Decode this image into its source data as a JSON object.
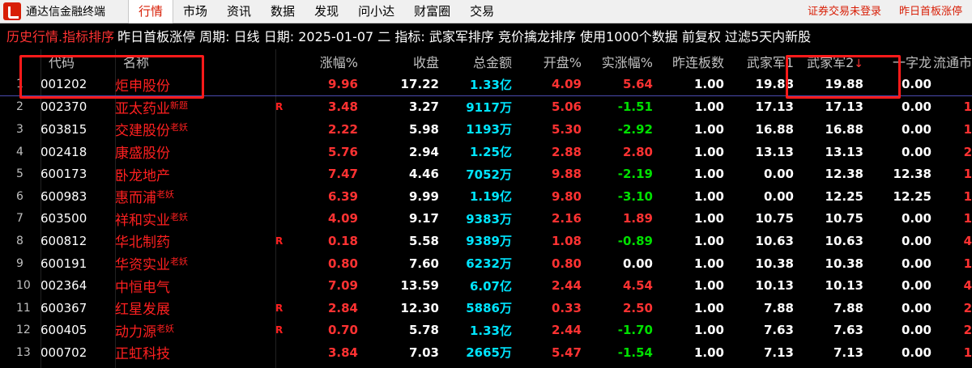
{
  "menubar": {
    "app_title": "通达信金融终端",
    "items": [
      "行情",
      "市场",
      "资讯",
      "数据",
      "发现",
      "问小达",
      "财富圈",
      "交易"
    ],
    "active": 0,
    "status_login": "证券交易未登录",
    "status_panel": "昨日首板涨停"
  },
  "infobar": {
    "history_label": "历史行情.指标排序",
    "details": "昨日首板涨停  周期: 日线  日期: 2025-01-07 二  指标: 武家军排序 竞价擒龙排序  使用1000个数据 前复权 过滤5天内新股"
  },
  "table": {
    "headers": {
      "code": "代码",
      "name": "名称",
      "pct": "涨幅%",
      "close": "收盘",
      "amount": "总金额",
      "open": "开盘%",
      "real": "实涨幅%",
      "lb": "昨连板数",
      "wj1": "武家军1",
      "wj2": "武家军2",
      "yzl": "一字龙",
      "ltz": "流通市"
    },
    "sort_arrow": "↓",
    "rows": [
      {
        "idx": "1",
        "code": "001202",
        "name": "炬申股份",
        "tag": "",
        "r": "",
        "pct": "9.96",
        "close": "17.22",
        "amount": "1.33亿",
        "open": "4.09",
        "real": "5.64",
        "lb": "1.00",
        "wj1": "19.88",
        "wj2": "19.88",
        "yzl": "0.00",
        "ltz": ""
      },
      {
        "idx": "2",
        "code": "002370",
        "name": "亚太药业",
        "tag": "新题",
        "r": "R",
        "pct": "3.48",
        "close": "3.27",
        "amount": "9117万",
        "open": "5.06",
        "real": "-1.51",
        "lb": "1.00",
        "wj1": "17.13",
        "wj2": "17.13",
        "yzl": "0.00",
        "ltz": "1"
      },
      {
        "idx": "3",
        "code": "603815",
        "name": "交建股份",
        "tag": "老妖",
        "r": "",
        "pct": "2.22",
        "close": "5.98",
        "amount": "1193万",
        "open": "5.30",
        "real": "-2.92",
        "lb": "1.00",
        "wj1": "16.88",
        "wj2": "16.88",
        "yzl": "0.00",
        "ltz": "1"
      },
      {
        "idx": "4",
        "code": "002418",
        "name": "康盛股份",
        "tag": "",
        "r": "",
        "pct": "5.76",
        "close": "2.94",
        "amount": "1.25亿",
        "open": "2.88",
        "real": "2.80",
        "lb": "1.00",
        "wj1": "13.13",
        "wj2": "13.13",
        "yzl": "0.00",
        "ltz": "2"
      },
      {
        "idx": "5",
        "code": "600173",
        "name": "卧龙地产",
        "tag": "",
        "r": "",
        "pct": "7.47",
        "close": "4.46",
        "amount": "7052万",
        "open": "9.88",
        "real": "-2.19",
        "lb": "1.00",
        "wj1": "0.00",
        "wj2": "12.38",
        "yzl": "12.38",
        "ltz": "1"
      },
      {
        "idx": "6",
        "code": "600983",
        "name": "惠而浦",
        "tag": "老妖",
        "r": "",
        "pct": "6.39",
        "close": "9.99",
        "amount": "1.19亿",
        "open": "9.80",
        "real": "-3.10",
        "lb": "1.00",
        "wj1": "0.00",
        "wj2": "12.25",
        "yzl": "12.25",
        "ltz": "1"
      },
      {
        "idx": "7",
        "code": "603500",
        "name": "祥和实业",
        "tag": "老妖",
        "r": "",
        "pct": "4.09",
        "close": "9.17",
        "amount": "9383万",
        "open": "2.16",
        "real": "1.89",
        "lb": "1.00",
        "wj1": "10.75",
        "wj2": "10.75",
        "yzl": "0.00",
        "ltz": "1"
      },
      {
        "idx": "8",
        "code": "600812",
        "name": "华北制药",
        "tag": "",
        "r": "R",
        "pct": "0.18",
        "close": "5.58",
        "amount": "9389万",
        "open": "1.08",
        "real": "-0.89",
        "lb": "1.00",
        "wj1": "10.63",
        "wj2": "10.63",
        "yzl": "0.00",
        "ltz": "4"
      },
      {
        "idx": "9",
        "code": "600191",
        "name": "华资实业",
        "tag": "老妖",
        "r": "",
        "pct": "0.80",
        "close": "7.60",
        "amount": "6232万",
        "open": "0.80",
        "real": "0.00",
        "lb": "1.00",
        "wj1": "10.38",
        "wj2": "10.38",
        "yzl": "0.00",
        "ltz": "1"
      },
      {
        "idx": "10",
        "code": "002364",
        "name": "中恒电气",
        "tag": "",
        "r": "",
        "pct": "7.09",
        "close": "13.59",
        "amount": "6.07亿",
        "open": "2.44",
        "real": "4.54",
        "lb": "1.00",
        "wj1": "10.13",
        "wj2": "10.13",
        "yzl": "0.00",
        "ltz": "4"
      },
      {
        "idx": "11",
        "code": "600367",
        "name": "红星发展",
        "tag": "",
        "r": "R",
        "pct": "2.84",
        "close": "12.30",
        "amount": "5886万",
        "open": "0.33",
        "real": "2.50",
        "lb": "1.00",
        "wj1": "7.88",
        "wj2": "7.88",
        "yzl": "0.00",
        "ltz": "2"
      },
      {
        "idx": "12",
        "code": "600405",
        "name": "动力源",
        "tag": "老妖",
        "r": "R",
        "pct": "0.70",
        "close": "5.78",
        "amount": "1.33亿",
        "open": "2.44",
        "real": "-1.70",
        "lb": "1.00",
        "wj1": "7.63",
        "wj2": "7.63",
        "yzl": "0.00",
        "ltz": "2"
      },
      {
        "idx": "13",
        "code": "000702",
        "name": "正虹科技",
        "tag": "",
        "r": "",
        "pct": "3.84",
        "close": "7.03",
        "amount": "2665万",
        "open": "5.47",
        "real": "-1.54",
        "lb": "1.00",
        "wj1": "7.13",
        "wj2": "7.13",
        "yzl": "0.00",
        "ltz": "1"
      }
    ]
  }
}
